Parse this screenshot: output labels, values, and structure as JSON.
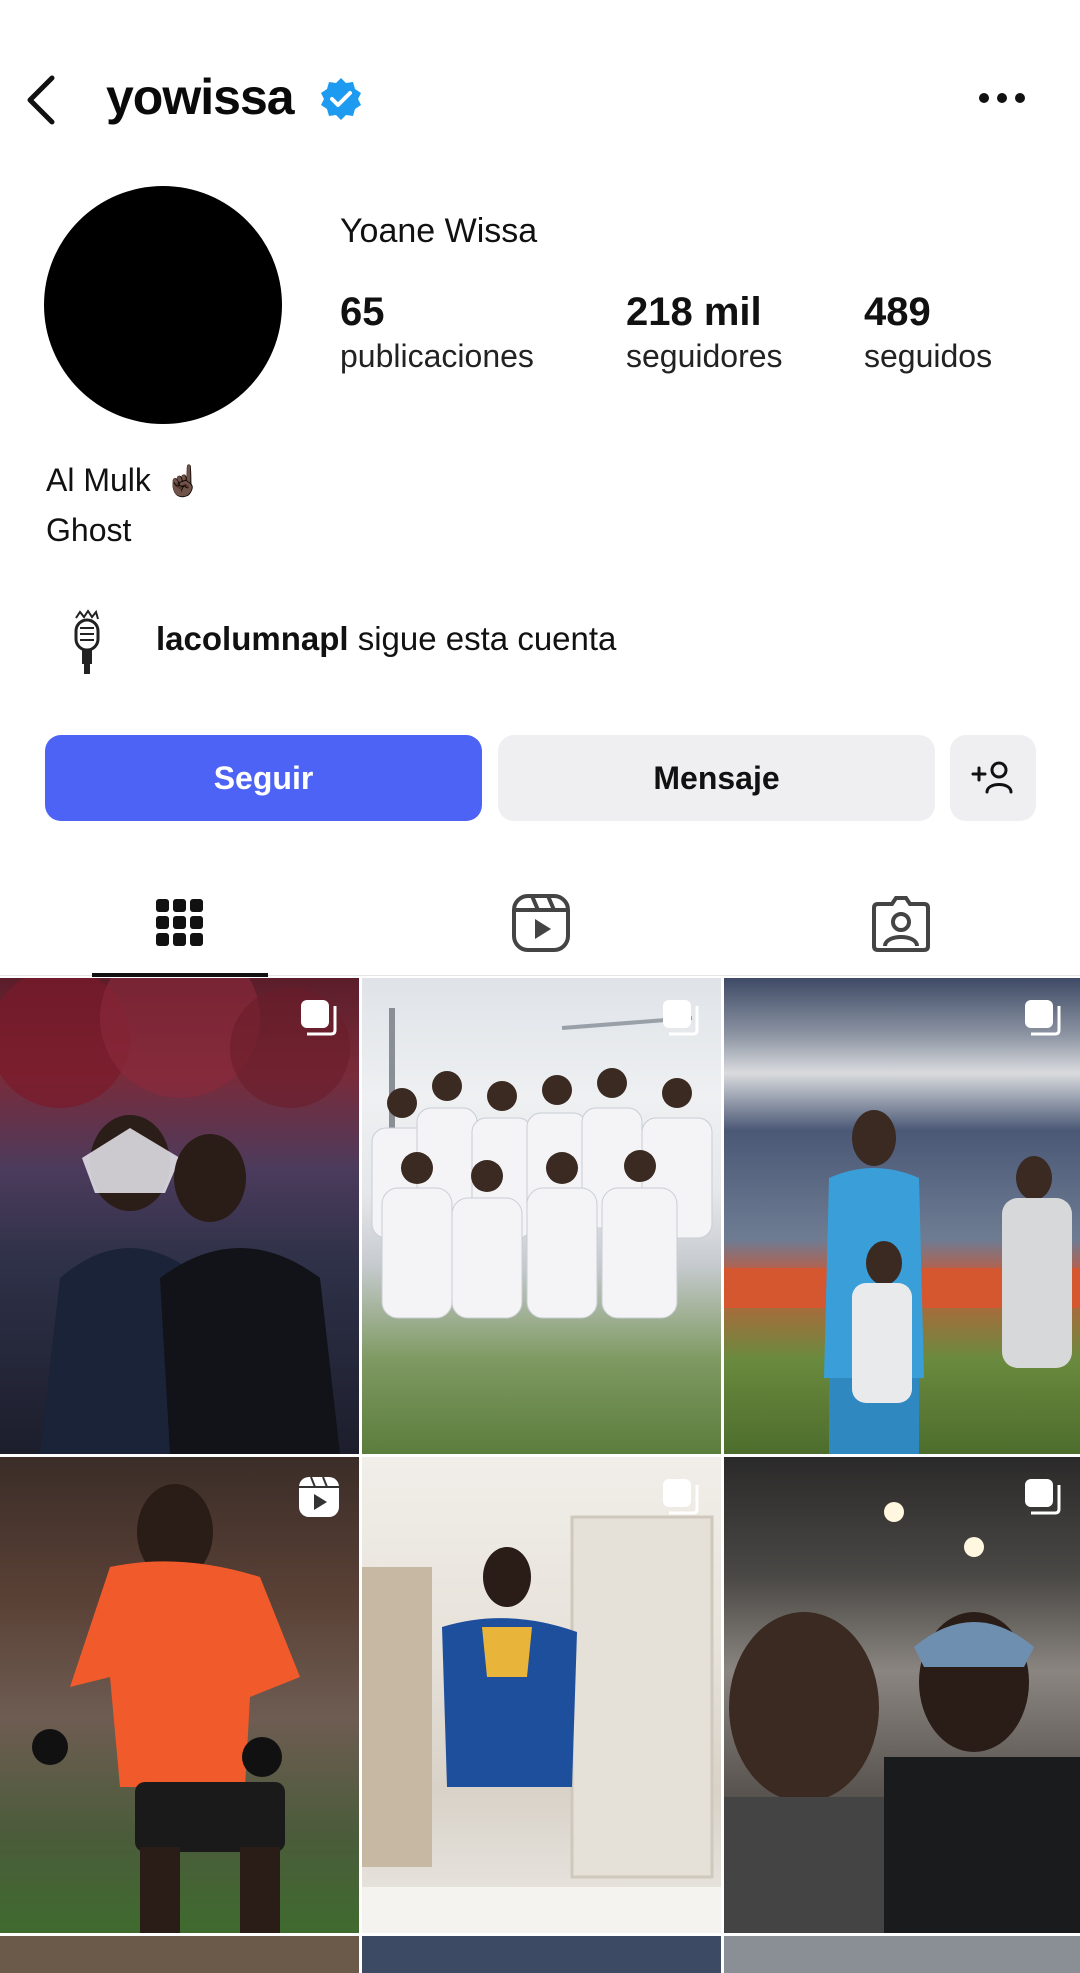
{
  "header": {
    "username": "yowissa",
    "verified": true,
    "back_icon": "chevron-left-icon",
    "more_icon": "more-horizontal-icon"
  },
  "profile": {
    "full_name": "Yoane Wissa",
    "stats": [
      {
        "value": "65",
        "label": "publicaciones"
      },
      {
        "value": "218 mil",
        "label": "seguidores"
      },
      {
        "value": "489",
        "label": "seguidos"
      }
    ],
    "bio": {
      "line1": "Al Mulk",
      "line1_emoji": "☝🏿",
      "line2": "Ghost"
    }
  },
  "followed_by": {
    "account": "lacolumnapl",
    "text": " sigue esta cuenta"
  },
  "actions": {
    "follow_label": "Seguir",
    "message_label": "Mensaje",
    "add_user_icon": "add-user-icon"
  },
  "colors": {
    "accent": "#4d63f5",
    "verified_blue": "#1d9bf0",
    "secondary_button": "#efeff1"
  },
  "tabs": [
    {
      "name": "posts",
      "icon": "grid-icon",
      "selected": true
    },
    {
      "name": "reels",
      "icon": "reels-icon",
      "selected": false
    },
    {
      "name": "tagged",
      "icon": "tagged-user-icon",
      "selected": false
    }
  ],
  "posts": [
    {
      "type": "carousel"
    },
    {
      "type": "carousel"
    },
    {
      "type": "carousel"
    },
    {
      "type": "reel"
    },
    {
      "type": "carousel"
    },
    {
      "type": "carousel"
    }
  ]
}
